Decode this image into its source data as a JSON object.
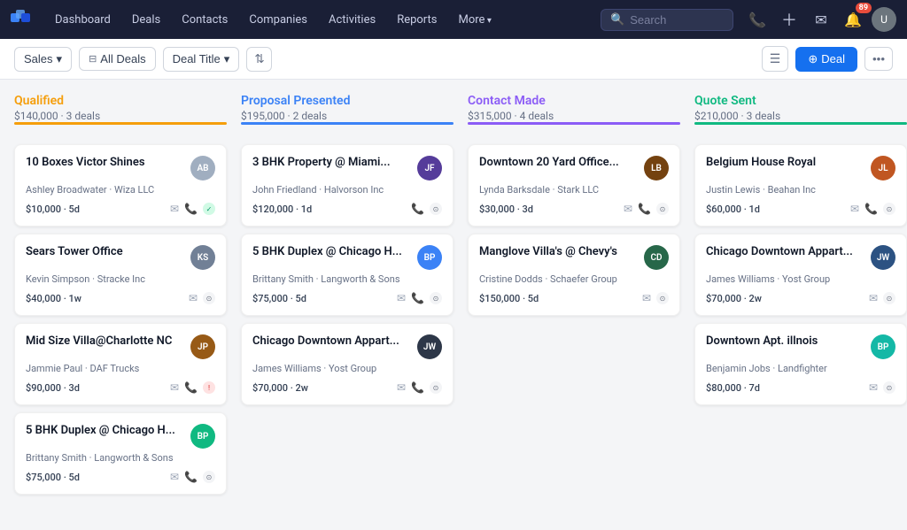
{
  "nav": {
    "items": [
      "Dashboard",
      "Deals",
      "Contacts",
      "Companies",
      "Activities",
      "Reports"
    ],
    "more_label": "More",
    "search_placeholder": "Search",
    "badge_count": "89"
  },
  "toolbar": {
    "sales_label": "Sales",
    "filter_label": "All Deals",
    "sort_label": "Deal Title",
    "deal_button": "+ Deal"
  },
  "columns": [
    {
      "id": "qualified",
      "title": "Qualified",
      "amount": "$140,000",
      "deals": "3 deals",
      "color_class": "col-qualified",
      "cards": [
        {
          "title": "10 Boxes Victor Shines",
          "subtitle": "Ashley Broadwater · Wiza LLC",
          "amount": "$10,000",
          "time": "5d",
          "avatar_initials": "",
          "avatar_class": "av-photo",
          "avatar_color": "#a0aec0",
          "has_email": true,
          "has_phone": true,
          "status": "green"
        },
        {
          "title": "Sears Tower Office",
          "subtitle": "Kevin Simpson · Stracke Inc",
          "amount": "$40,000",
          "time": "1w",
          "avatar_initials": "",
          "avatar_class": "av-photo2",
          "avatar_color": "#718096",
          "has_email": true,
          "has_phone": false,
          "status": "gray"
        },
        {
          "title": "Mid Size Villa@Charlotte NC",
          "subtitle": "Jammie Paul · DAF Trucks",
          "amount": "$90,000",
          "time": "3d",
          "avatar_initials": "",
          "avatar_class": "av-photo3",
          "avatar_color": "#975a16",
          "has_email": true,
          "has_phone": true,
          "status": "red"
        },
        {
          "title": "5 BHK Duplex @ Chicago H...",
          "subtitle": "Brittany Smith · Langworth & Sons",
          "amount": "$75,000",
          "time": "5d",
          "avatar_initials": "BP",
          "avatar_class": "av-green",
          "avatar_color": "#10b981",
          "has_email": true,
          "has_phone": true,
          "status": "gray"
        }
      ]
    },
    {
      "id": "proposal",
      "title": "Proposal Presented",
      "amount": "$195,000",
      "deals": "2 deals",
      "color_class": "col-proposal",
      "cards": [
        {
          "title": "3 BHK Property @ Miami...",
          "subtitle": "John Friedland · Halvorson Inc",
          "amount": "$120,000",
          "time": "1d",
          "avatar_initials": "",
          "avatar_class": "av-photo4",
          "avatar_color": "#553c9a",
          "has_email": false,
          "has_phone": true,
          "status": "gray"
        },
        {
          "title": "5 BHK Duplex @ Chicago H...",
          "subtitle": "Brittany Smith · Langworth & Sons",
          "amount": "$75,000",
          "time": "5d",
          "avatar_initials": "BP",
          "avatar_class": "av-blue",
          "avatar_color": "#3b82f6",
          "has_email": true,
          "has_phone": true,
          "status": "gray"
        },
        {
          "title": "Chicago Downtown Appart...",
          "subtitle": "James Williams · Yost Group",
          "amount": "$70,000",
          "time": "2w",
          "avatar_initials": "",
          "avatar_class": "av-photo5",
          "avatar_color": "#2d3748",
          "has_email": true,
          "has_phone": true,
          "status": "gray"
        }
      ]
    },
    {
      "id": "contact",
      "title": "Contact Made",
      "amount": "$315,000",
      "deals": "4 deals",
      "color_class": "col-contact",
      "cards": [
        {
          "title": "Downtown 20 Yard Office...",
          "subtitle": "Lynda Barksdale · Stark LLC",
          "amount": "$30,000",
          "time": "3d",
          "avatar_initials": "",
          "avatar_class": "av-photo6",
          "avatar_color": "#744210",
          "has_email": true,
          "has_phone": true,
          "status": "gray"
        },
        {
          "title": "Manglove Villa's @ Chevy's",
          "subtitle": "Cristine Dodds · Schaefer Group",
          "amount": "$150,000",
          "time": "5d",
          "avatar_initials": "",
          "avatar_class": "av-photo7",
          "avatar_color": "#276749",
          "has_email": true,
          "has_phone": false,
          "status": "gray"
        }
      ]
    },
    {
      "id": "quote",
      "title": "Quote Sent",
      "amount": "$210,000",
      "deals": "3 deals",
      "color_class": "col-quote",
      "cards": [
        {
          "title": "Belgium House Royal",
          "subtitle": "Justin Lewis · Beahan Inc",
          "amount": "$60,000",
          "time": "1d",
          "avatar_initials": "",
          "avatar_class": "av-photo8",
          "avatar_color": "#c05621",
          "has_email": true,
          "has_phone": true,
          "status": "gray"
        },
        {
          "title": "Chicago Downtown Appart...",
          "subtitle": "James Williams · Yost Group",
          "amount": "$70,000",
          "time": "2w",
          "avatar_initials": "",
          "avatar_class": "av-photo9",
          "avatar_color": "#2c5282",
          "has_email": true,
          "has_phone": false,
          "status": "gray"
        },
        {
          "title": "Downtown Apt. illnois",
          "subtitle": "Benjamin Jobs · Landfighter",
          "amount": "$80,000",
          "time": "7d",
          "avatar_initials": "BP",
          "avatar_class": "av-teal",
          "avatar_color": "#14b8a6",
          "has_email": true,
          "has_phone": false,
          "status": "gray"
        }
      ]
    }
  ]
}
